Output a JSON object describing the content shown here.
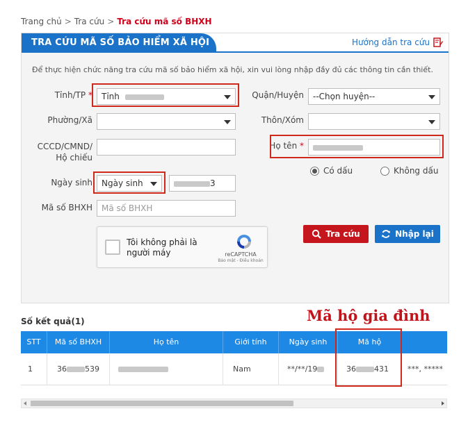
{
  "breadcrumb": {
    "items": [
      "Trang chủ",
      "Tra cứu"
    ],
    "separator": ">",
    "current": "Tra cứu mã số BHXH"
  },
  "panel": {
    "title": "TRA CỨU MÃ SỐ BẢO HIỂM XÃ HỘI",
    "guide_link": "Hướng dẫn tra cứu"
  },
  "form": {
    "intro": "Để thực hiện chức năng tra cứu mã số bảo hiểm xã hội, xin vui lòng nhập đầy đủ các thông tin cần thiết.",
    "province": {
      "label": "Tỉnh/TP",
      "required": "*",
      "value": "Tỉnh"
    },
    "district": {
      "label": "Quận/Huyện",
      "value": "--Chọn huyện--"
    },
    "ward": {
      "label": "Phường/Xã",
      "value": ""
    },
    "village": {
      "label": "Thôn/Xóm",
      "value": ""
    },
    "id_card": {
      "label_line1": "CCCD/CMND/",
      "label_line2": "Hộ chiếu",
      "value": ""
    },
    "full_name": {
      "label": "Họ tên",
      "required": "*",
      "value": ""
    },
    "accent": {
      "with_accent": "Có dấu",
      "without_accent": "Không dấu",
      "selected": "with_accent"
    },
    "dob": {
      "label": "Ngày sinh",
      "type_value": "Ngày sinh",
      "value_suffix": "3"
    },
    "bhxh": {
      "label": "Mã số BHXH",
      "placeholder": "Mã số BHXH"
    }
  },
  "captcha": {
    "text": "Tôi không phải là người máy",
    "brand": "reCAPTCHA",
    "links": "Bảo mật - Điều khoản"
  },
  "buttons": {
    "search": "Tra cứu",
    "reset": "Nhập lại"
  },
  "results": {
    "count_label": "Số kết quả(1)",
    "annotation": "Mã hộ gia đình",
    "columns": [
      "STT",
      "Mã số BHXH",
      "Họ tên",
      "Giới tính",
      "Ngày sinh",
      "Mã hộ",
      ""
    ],
    "rows": [
      {
        "stt": "1",
        "bhxh_prefix": "36",
        "bhxh_suffix": "539",
        "gender": "Nam",
        "dob": "**/**/19",
        "household_prefix": "36",
        "household_suffix": "431",
        "extra": "***, *****"
      }
    ]
  },
  "colors": {
    "primary": "#1a73c9",
    "table_header": "#1e88e5",
    "danger": "#c4161c",
    "highlight": "#d0281b"
  }
}
